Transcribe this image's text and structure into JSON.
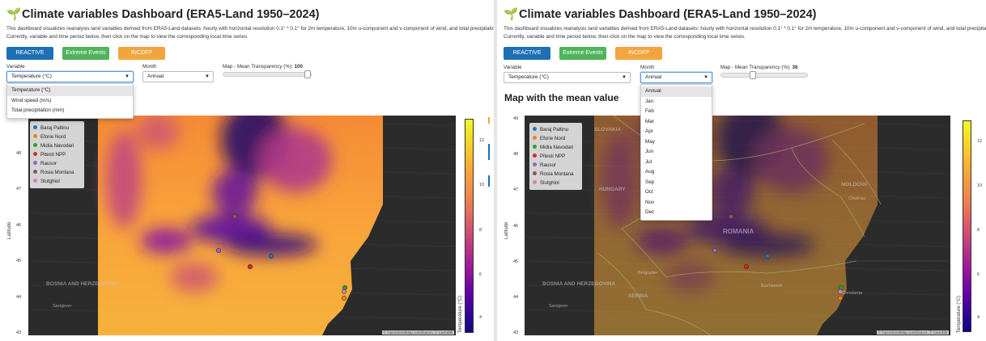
{
  "app": {
    "title": "Climate variables Dashboard (ERA5-Land 1950–2024)",
    "logo_icon": "sprout-icon",
    "description": "This dashboard visualizes reanalysis land variables derived from ERA5-Land datasets: hourly with horizontal resolution 0.1° * 0.1° for 2m temperature, 10m u-component and v-component of wind, and total precipitation. Currently, variable and time period below, then click on the map to view the corresponding local time series."
  },
  "buttons": [
    {
      "label": "REACTIVE",
      "color": "#1f6fb5"
    },
    {
      "label": "Extreme Events",
      "color": "#4fb45c"
    },
    {
      "label": "INCDFP",
      "color": "#f0a63c"
    }
  ],
  "controls": {
    "variable_label": "Variable",
    "variable_value": "Temperature (°C)",
    "month_label": "Month",
    "month_value": "Annual",
    "left_transparency_label": "Map - Mean Transparency (%):",
    "left_transparency_value": "100",
    "left_transparency_fraction": 1.0,
    "right_transparency_label": "Map - Mean Transparency (%):",
    "right_transparency_value": "36",
    "right_transparency_fraction": 0.36
  },
  "variable_options": [
    "Temperature (°C)",
    "Wind speed (m/s)",
    "Total precipitation (mm)"
  ],
  "month_options": [
    "Annual",
    "Jan",
    "Feb",
    "Mar",
    "Apr",
    "May",
    "Jun",
    "Jul",
    "Aug",
    "Sep",
    "Oct",
    "Nov",
    "Dec"
  ],
  "right_heading": "Map with the mean value",
  "legend": [
    {
      "name": "Baraj Paltinu",
      "color": "#1f77b4"
    },
    {
      "name": "Eforie Nord",
      "color": "#ff7f0e"
    },
    {
      "name": "Midia Navodari",
      "color": "#2ca02c"
    },
    {
      "name": "Pitesti NPP",
      "color": "#d62728"
    },
    {
      "name": "Rausor",
      "color": "#9467bd"
    },
    {
      "name": "Rosia Montana",
      "color": "#8c564b"
    },
    {
      "name": "Slutghiol",
      "color": "#e377c2"
    }
  ],
  "map": {
    "lat_label": "Latitude",
    "lat_ticks": [
      "49",
      "48",
      "47",
      "46",
      "45",
      "44",
      "43"
    ],
    "attribution": "© OpenStreetMap contributors, © CartoDB",
    "colorbar_label": "Temperature (°C)",
    "colorbar_ticks": [
      "12",
      "10",
      "8",
      "6",
      "4"
    ],
    "country_labels_left": [
      "BOSNIA AND HERZEGOVINA"
    ],
    "city_labels_left": [
      "Sarajevo"
    ],
    "country_labels_right": [
      "SLOVAKIA",
      "HUNGARY",
      "MOLDOVA",
      "ROMANIA",
      "SERBIA",
      "BOSNIA AND HERZEGOVINA"
    ],
    "city_labels_right": [
      "Belgrade",
      "Bucharest",
      "Constanța",
      "Sarajevo",
      "Chisinau"
    ]
  }
}
